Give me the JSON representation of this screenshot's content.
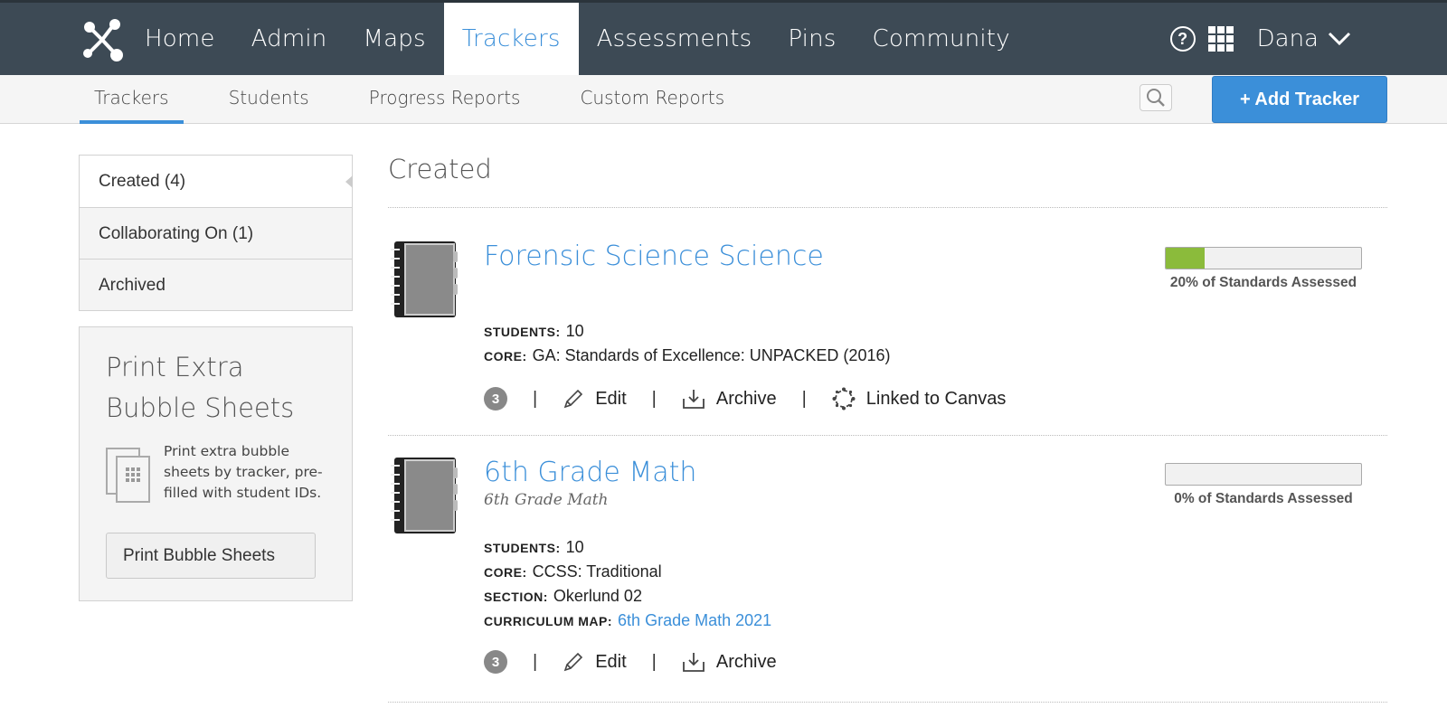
{
  "topnav": {
    "items": [
      {
        "label": "Home"
      },
      {
        "label": "Admin"
      },
      {
        "label": "Maps"
      },
      {
        "label": "Trackers"
      },
      {
        "label": "Assessments"
      },
      {
        "label": "Pins"
      },
      {
        "label": "Community"
      }
    ],
    "active_index": 3,
    "user_name": "Dana",
    "help_glyph": "?"
  },
  "subnav": {
    "items": [
      {
        "label": "Trackers"
      },
      {
        "label": "Students"
      },
      {
        "label": "Progress Reports"
      },
      {
        "label": "Custom Reports"
      }
    ],
    "active_index": 0,
    "add_button": "+ Add Tracker"
  },
  "sidebar": {
    "tabs": [
      {
        "label": "Created (4)"
      },
      {
        "label": "Collaborating On (1)"
      },
      {
        "label": "Archived"
      }
    ],
    "active_index": 0,
    "print_panel": {
      "title": "Print Extra Bubble Sheets",
      "description": "Print extra bubble sheets by tracker, pre-filled with student IDs.",
      "button": "Print Bubble Sheets"
    }
  },
  "main": {
    "heading": "Created",
    "trackers": [
      {
        "title": "Forensic Science Science",
        "subtitle": "",
        "progress_percent": 20,
        "progress_label": "20% of Standards Assessed",
        "fields": [
          {
            "key": "STUDENTS:",
            "value": "10"
          },
          {
            "key": "CORE:",
            "value": "GA: Standards of Excellence: UNPACKED (2016)"
          }
        ],
        "badge": "3",
        "edit": "Edit",
        "archive": "Archive",
        "linked": "Linked to Canvas"
      },
      {
        "title": "6th Grade Math",
        "subtitle": "6th Grade Math",
        "progress_percent": 0,
        "progress_label": "0% of Standards Assessed",
        "fields": [
          {
            "key": "STUDENTS:",
            "value": "10"
          },
          {
            "key": "CORE:",
            "value": "CCSS: Traditional"
          },
          {
            "key": "SECTION:",
            "value": "Okerlund 02"
          },
          {
            "key": "CURRICULUM MAP:",
            "value": "6th Grade Math 2021"
          }
        ],
        "badge": "3",
        "edit": "Edit",
        "archive": "Archive"
      }
    ]
  },
  "colors": {
    "topbar": "#3d4a55",
    "accent": "#3b8fd9",
    "progress_fill": "#8bbb3b"
  },
  "icons": [
    "network-logo-icon",
    "help-icon",
    "apps-grid-icon",
    "chevron-down-icon",
    "search-icon",
    "notebook-icon",
    "pencil-icon",
    "archive-tray-icon",
    "canvas-icon",
    "sheet-stack-icon"
  ]
}
